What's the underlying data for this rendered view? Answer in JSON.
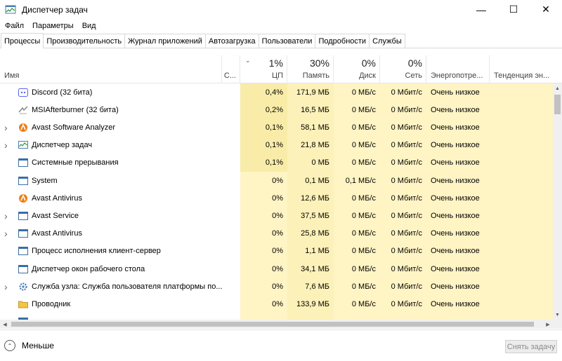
{
  "window": {
    "title": "Диспетчер задач",
    "minimize": "—",
    "maximize": "☐",
    "close": "✕"
  },
  "menu": [
    "Файл",
    "Параметры",
    "Вид"
  ],
  "tabs": [
    "Процессы",
    "Производительность",
    "Журнал приложений",
    "Автозагрузка",
    "Пользователи",
    "Подробности",
    "Службы"
  ],
  "columns": {
    "name": "Имя",
    "status": "С...",
    "cpu_pct": "1%",
    "cpu": "ЦП",
    "mem_pct": "30%",
    "mem": "Память",
    "disk_pct": "0%",
    "disk": "Диск",
    "net_pct": "0%",
    "net": "Сеть",
    "power": "Энергопотре...",
    "power_trend": "Тенденция эн..."
  },
  "colors": {
    "heat_light": "#fff4c4",
    "heat_strong": "#f9eca8",
    "heat_mid": "#fcf1b8",
    "accent": "#2d7d9a"
  },
  "processes": [
    {
      "name": "Discord (32 бита)",
      "icon": "discord-icon",
      "expandable": false,
      "cpu": "0,4%",
      "mem": "171,9 МБ",
      "disk": "0 МБ/с",
      "net": "0 Мбит/с",
      "power": "Очень низкое"
    },
    {
      "name": "MSIAfterburner (32 бита)",
      "icon": "afterburner-icon",
      "expandable": false,
      "cpu": "0,2%",
      "mem": "16,5 МБ",
      "disk": "0 МБ/с",
      "net": "0 Мбит/с",
      "power": "Очень низкое"
    },
    {
      "name": "Avast Software Analyzer",
      "icon": "avast-icon",
      "expandable": true,
      "cpu": "0,1%",
      "mem": "58,1 МБ",
      "disk": "0 МБ/с",
      "net": "0 Мбит/с",
      "power": "Очень низкое"
    },
    {
      "name": "Диспетчер задач",
      "icon": "taskmgr-icon",
      "expandable": true,
      "cpu": "0,1%",
      "mem": "21,8 МБ",
      "disk": "0 МБ/с",
      "net": "0 Мбит/с",
      "power": "Очень низкое"
    },
    {
      "name": "Системные прерывания",
      "icon": "window-icon",
      "expandable": false,
      "cpu": "0,1%",
      "mem": "0 МБ",
      "disk": "0 МБ/с",
      "net": "0 Мбит/с",
      "power": "Очень низкое"
    },
    {
      "name": "System",
      "icon": "window-icon",
      "expandable": false,
      "cpu": "0%",
      "mem": "0,1 МБ",
      "disk": "0,1 МБ/с",
      "net": "0 Мбит/с",
      "power": "Очень низкое"
    },
    {
      "name": "Avast Antivirus",
      "icon": "avast-icon",
      "expandable": false,
      "cpu": "0%",
      "mem": "12,6 МБ",
      "disk": "0 МБ/с",
      "net": "0 Мбит/с",
      "power": "Очень низкое"
    },
    {
      "name": "Avast Service",
      "icon": "window-icon",
      "expandable": true,
      "cpu": "0%",
      "mem": "37,5 МБ",
      "disk": "0 МБ/с",
      "net": "0 Мбит/с",
      "power": "Очень низкое"
    },
    {
      "name": "Avast Antivirus",
      "icon": "window-icon",
      "expandable": true,
      "cpu": "0%",
      "mem": "25,8 МБ",
      "disk": "0 МБ/с",
      "net": "0 Мбит/с",
      "power": "Очень низкое"
    },
    {
      "name": "Процесс исполнения клиент-сервер",
      "icon": "window-icon",
      "expandable": false,
      "cpu": "0%",
      "mem": "1,1 МБ",
      "disk": "0 МБ/с",
      "net": "0 Мбит/с",
      "power": "Очень низкое"
    },
    {
      "name": "Диспетчер окон рабочего стола",
      "icon": "window-icon",
      "expandable": false,
      "cpu": "0%",
      "mem": "34,1 МБ",
      "disk": "0 МБ/с",
      "net": "0 Мбит/с",
      "power": "Очень низкое"
    },
    {
      "name": "Служба узла: Служба пользователя платформы по...",
      "icon": "gear-icon",
      "expandable": true,
      "cpu": "0%",
      "mem": "7,6 МБ",
      "disk": "0 МБ/с",
      "net": "0 Мбит/с",
      "power": "Очень низкое"
    },
    {
      "name": "Проводник",
      "icon": "folder-icon",
      "expandable": false,
      "cpu": "0%",
      "mem": "133,9 МБ",
      "disk": "0 МБ/с",
      "net": "0 Мбит/с",
      "power": "Очень низкое"
    },
    {
      "name": "",
      "icon": "window-icon",
      "expandable": false,
      "cpu": "",
      "mem": "",
      "disk": "",
      "net": "",
      "power": ""
    }
  ],
  "footer": {
    "less": "Меньше",
    "end_task": "Снять задачу"
  }
}
